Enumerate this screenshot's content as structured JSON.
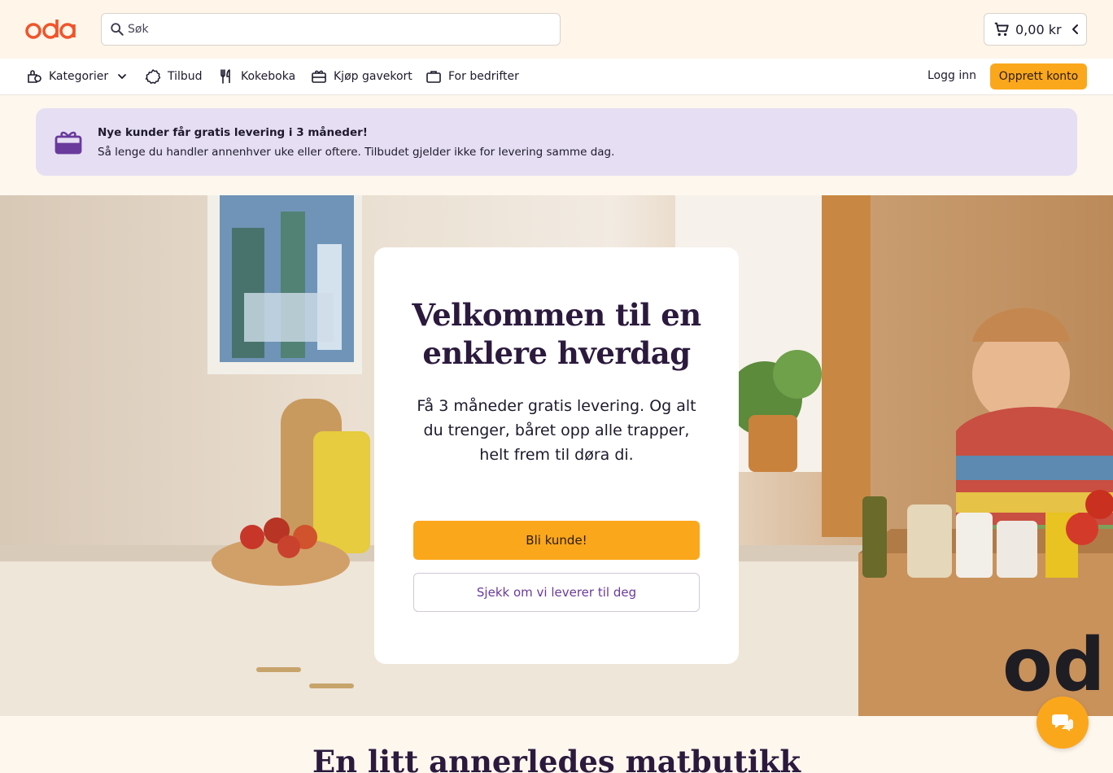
{
  "brand": {
    "logo_text": "oda",
    "accent": "#fba71c",
    "logo_color": "#f0542c"
  },
  "search": {
    "placeholder": "Søk",
    "icon": "search-icon"
  },
  "cart": {
    "amount": "0,00 kr",
    "icon": "cart-icon"
  },
  "nav": {
    "items": [
      {
        "label": "Kategorier",
        "icon": "categories-icon"
      },
      {
        "label": "Tilbud",
        "icon": "badge-icon"
      },
      {
        "label": "Kokeboka",
        "icon": "fork-knife-icon"
      },
      {
        "label": "Kjøp gavekort",
        "icon": "gift-card-icon"
      },
      {
        "label": "For bedrifter",
        "icon": "briefcase-icon"
      }
    ],
    "login": "Logg inn",
    "signup": "Opprett konto"
  },
  "promo": {
    "title": "Nye kunder får gratis levering i 3 måneder!",
    "subtitle": "Så lenge du handler annenhver uke eller oftere. Tilbudet gjelder ikke for levering samme dag.",
    "icon": "gift-icon",
    "bg_color": "#e6dff3"
  },
  "hero": {
    "heading": "Velkommen til en enklere hverdag",
    "body": "Få 3 måneder gratis levering. Og alt du trenger, båret opp alle trapper, helt frem til døra di.",
    "primary_cta": "Bli kunde!",
    "secondary_cta": "Sjekk om vi leverer til deg"
  },
  "section": {
    "heading": "En litt annerledes matbutikk"
  },
  "chat": {
    "icon": "chat-icon"
  }
}
